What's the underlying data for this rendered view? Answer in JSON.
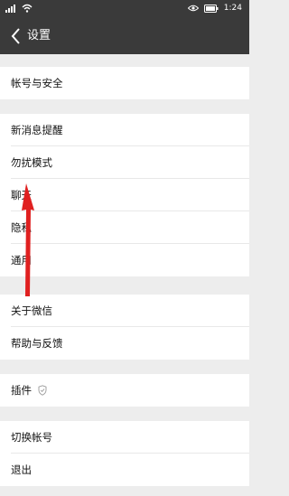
{
  "status_bar": {
    "left_icons": [
      "signal-icon",
      "wifi-icon"
    ],
    "right_icons": [
      "eye-icon",
      "battery-icon"
    ],
    "time": "1:24"
  },
  "header": {
    "back_icon": "chevron-left-icon",
    "title": "设置"
  },
  "groups": [
    {
      "items": [
        {
          "label": "帐号与安全"
        }
      ]
    },
    {
      "items": [
        {
          "label": "新消息提醒"
        },
        {
          "label": "勿扰模式"
        },
        {
          "label": "聊天"
        },
        {
          "label": "隐私"
        },
        {
          "label": "通用"
        }
      ]
    },
    {
      "items": [
        {
          "label": "关于微信"
        },
        {
          "label": "帮助与反馈"
        }
      ]
    },
    {
      "items": [
        {
          "label": "插件",
          "icon": "plugin-shield-icon"
        }
      ]
    },
    {
      "items": [
        {
          "label": "切换帐号"
        },
        {
          "label": "退出"
        }
      ]
    }
  ],
  "colors": {
    "header_bg": "#3a3a3a",
    "page_bg": "#ededed",
    "annotation_arrow": "#e02020"
  }
}
